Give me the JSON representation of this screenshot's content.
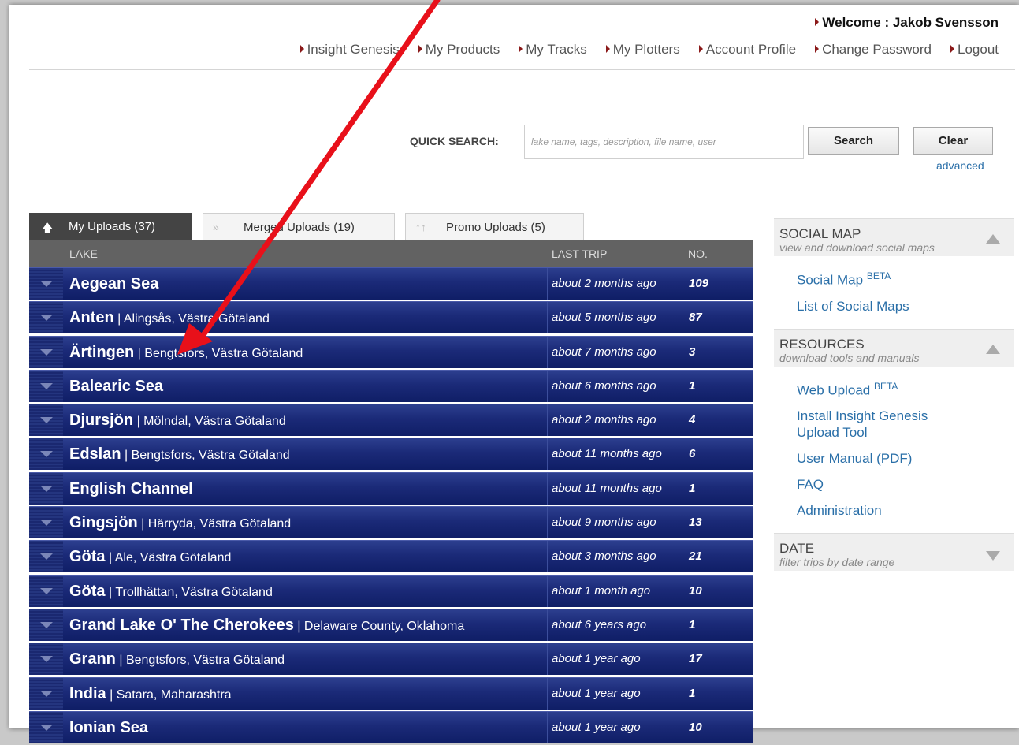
{
  "header": {
    "welcome": "Welcome : Jakob Svensson",
    "nav": [
      "Insight Genesis",
      "My Products",
      "My Tracks",
      "My Plotters",
      "Account Profile",
      "Change Password",
      "Logout"
    ]
  },
  "search": {
    "label": "QUICK SEARCH:",
    "placeholder": "lake name, tags, description, file name, user",
    "search_button": "Search",
    "clear_button": "Clear",
    "advanced_link": "advanced"
  },
  "tabs": [
    {
      "label": "My Uploads (37)",
      "active": true
    },
    {
      "label": "Merged Uploads (19)",
      "active": false
    },
    {
      "label": "Promo Uploads (5)",
      "active": false
    }
  ],
  "table": {
    "headers": {
      "lake": "LAKE",
      "last_trip": "LAST TRIP",
      "no": "NO."
    },
    "rows": [
      {
        "name": "Aegean Sea",
        "location": "",
        "last_trip": "about 2 months ago",
        "no": "109"
      },
      {
        "name": "Anten",
        "location": "| Alingsås, Västra Götaland",
        "last_trip": "about 5 months ago",
        "no": "87"
      },
      {
        "name": "Ärtingen",
        "location": "| Bengtsfors, Västra Götaland",
        "last_trip": "about 7 months ago",
        "no": "3"
      },
      {
        "name": "Balearic Sea",
        "location": "",
        "last_trip": "about 6 months ago",
        "no": "1"
      },
      {
        "name": "Djursjön",
        "location": "| Mölndal, Västra Götaland",
        "last_trip": "about 2 months ago",
        "no": "4"
      },
      {
        "name": "Edslan",
        "location": "| Bengtsfors, Västra Götaland",
        "last_trip": "about 11 months ago",
        "no": "6"
      },
      {
        "name": "English Channel",
        "location": "",
        "last_trip": "about 11 months ago",
        "no": "1"
      },
      {
        "name": "Gingsjön",
        "location": "| Härryda, Västra Götaland",
        "last_trip": "about 9 months ago",
        "no": "13"
      },
      {
        "name": "Göta",
        "location": "| Ale, Västra Götaland",
        "last_trip": "about 3 months ago",
        "no": "21"
      },
      {
        "name": "Göta",
        "location": "| Trollhättan, Västra Götaland",
        "last_trip": "about 1 month ago",
        "no": "10"
      },
      {
        "name": "Grand Lake O' The Cherokees",
        "location": "| Delaware County, Oklahoma",
        "last_trip": "about 6 years ago",
        "no": "1"
      },
      {
        "name": "Grann",
        "location": "| Bengtsfors, Västra Götaland",
        "last_trip": "about 1 year ago",
        "no": "17"
      },
      {
        "name": "India",
        "location": "| Satara, Maharashtra",
        "last_trip": "about 1 year ago",
        "no": "1"
      },
      {
        "name": "Ionian Sea",
        "location": "",
        "last_trip": "about 1 year ago",
        "no": "10"
      }
    ]
  },
  "sidebar": {
    "social_map": {
      "title": "SOCIAL MAP",
      "subtitle": "view and download social maps",
      "links": [
        {
          "label": "Social Map",
          "sup": "BETA"
        },
        {
          "label": "List of Social Maps",
          "sup": ""
        }
      ]
    },
    "resources": {
      "title": "RESOURCES",
      "subtitle": "download tools and manuals",
      "links": [
        {
          "label": "Web Upload",
          "sup": "BETA"
        },
        {
          "label": "Install Insight Genesis Upload Tool",
          "sup": ""
        },
        {
          "label": "User Manual (PDF)",
          "sup": ""
        },
        {
          "label": "FAQ",
          "sup": ""
        },
        {
          "label": "Administration",
          "sup": ""
        }
      ]
    },
    "date": {
      "title": "DATE",
      "subtitle": "filter trips by date range"
    }
  },
  "colors": {
    "row_blue": "#1b2a78",
    "link_blue": "#2a6fa8",
    "annotation_arrow": "#e8101a"
  },
  "annotation": {
    "arrow_target": "Ärtingen row"
  }
}
